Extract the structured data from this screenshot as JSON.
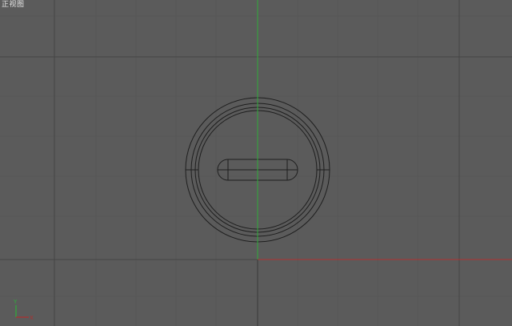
{
  "viewport": {
    "view_label": "正视图",
    "axis_gizmo": {
      "y_label": "Y",
      "x_label": "X"
    }
  },
  "colors": {
    "background": "#5b5b5b",
    "grid_major": "#4a4a4a",
    "grid_minor": "#555555",
    "wireframe": "#1e1e1e",
    "axis_green": "#2fae3a",
    "axis_red": "#b03030",
    "label_text": "#e6e6e6"
  }
}
